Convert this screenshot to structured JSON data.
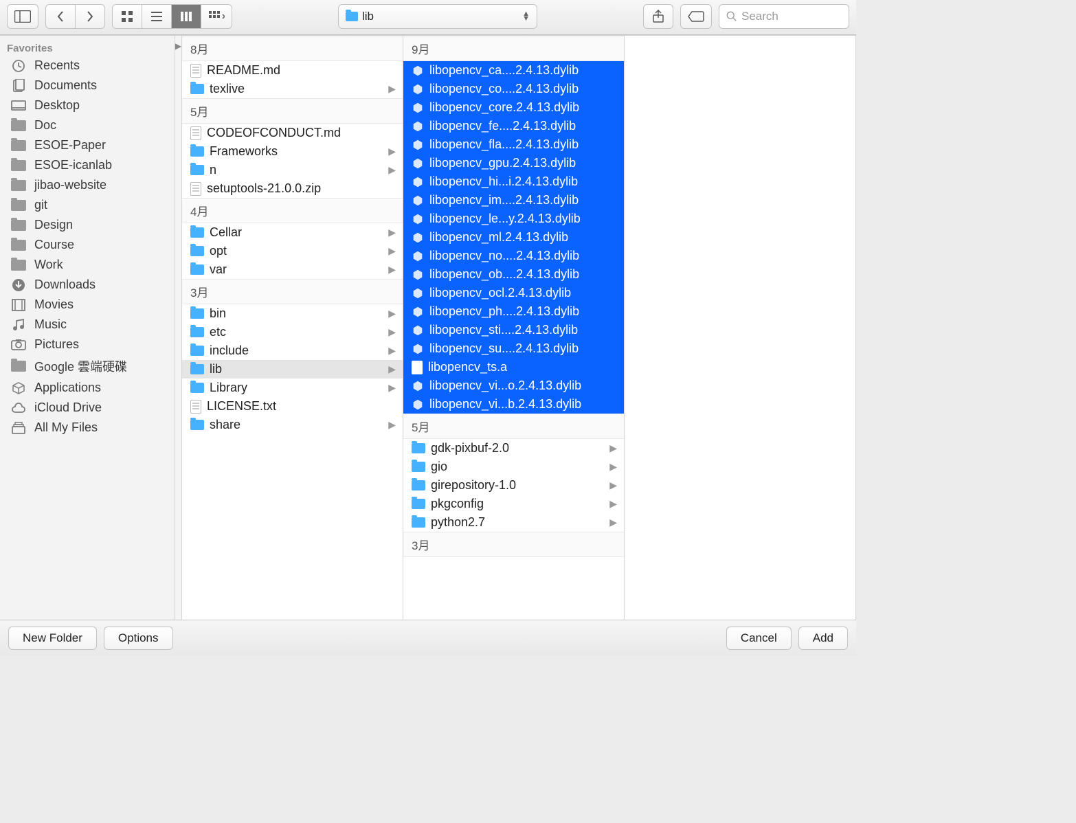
{
  "toolbar": {
    "path_label": "lib",
    "search_placeholder": "Search"
  },
  "sidebar": {
    "header": "Favorites",
    "items": [
      {
        "icon": "recents",
        "label": "Recents"
      },
      {
        "icon": "documents",
        "label": "Documents"
      },
      {
        "icon": "desktop",
        "label": "Desktop"
      },
      {
        "icon": "folder",
        "label": "Doc"
      },
      {
        "icon": "folder",
        "label": "ESOE-Paper"
      },
      {
        "icon": "folder",
        "label": "ESOE-icanlab"
      },
      {
        "icon": "folder",
        "label": "jibao-website"
      },
      {
        "icon": "folder",
        "label": "git"
      },
      {
        "icon": "folder",
        "label": "Design"
      },
      {
        "icon": "folder",
        "label": "Course"
      },
      {
        "icon": "folder",
        "label": "Work"
      },
      {
        "icon": "downloads",
        "label": "Downloads"
      },
      {
        "icon": "movies",
        "label": "Movies"
      },
      {
        "icon": "music",
        "label": "Music"
      },
      {
        "icon": "pictures",
        "label": "Pictures"
      },
      {
        "icon": "folder",
        "label": "Google 雲端硬碟"
      },
      {
        "icon": "applications",
        "label": "Applications"
      },
      {
        "icon": "icloud",
        "label": "iCloud Drive"
      },
      {
        "icon": "allfiles",
        "label": "All My Files"
      }
    ]
  },
  "column_mid": {
    "groups": [
      {
        "header": "8月",
        "items": [
          {
            "type": "doc",
            "name": "README.md"
          },
          {
            "type": "folder",
            "name": "texlive"
          }
        ]
      },
      {
        "header": "5月",
        "items": [
          {
            "type": "doc",
            "name": "CODEOFCONDUCT.md"
          },
          {
            "type": "folder",
            "name": "Frameworks"
          },
          {
            "type": "folder",
            "name": "n"
          },
          {
            "type": "doc",
            "name": "setuptools-21.0.0.zip"
          }
        ]
      },
      {
        "header": "4月",
        "items": [
          {
            "type": "folder",
            "name": "Cellar"
          },
          {
            "type": "folder",
            "name": "opt"
          },
          {
            "type": "folder",
            "name": "var"
          }
        ]
      },
      {
        "header": "3月",
        "items": [
          {
            "type": "folder",
            "name": "bin"
          },
          {
            "type": "folder",
            "name": "etc"
          },
          {
            "type": "folder",
            "name": "include"
          },
          {
            "type": "folder",
            "name": "lib",
            "selected": true
          },
          {
            "type": "folder",
            "name": "Library"
          },
          {
            "type": "doc",
            "name": "LICENSE.txt"
          },
          {
            "type": "folder",
            "name": "share"
          }
        ]
      }
    ]
  },
  "column_right": {
    "groups": [
      {
        "header": "9月",
        "selected": true,
        "items": [
          {
            "type": "dylib",
            "name": "libopencv_ca....2.4.13.dylib"
          },
          {
            "type": "dylib",
            "name": "libopencv_co....2.4.13.dylib"
          },
          {
            "type": "dylib",
            "name": "libopencv_core.2.4.13.dylib"
          },
          {
            "type": "dylib",
            "name": "libopencv_fe....2.4.13.dylib"
          },
          {
            "type": "dylib",
            "name": "libopencv_fla....2.4.13.dylib"
          },
          {
            "type": "dylib",
            "name": "libopencv_gpu.2.4.13.dylib"
          },
          {
            "type": "dylib",
            "name": "libopencv_hi...i.2.4.13.dylib"
          },
          {
            "type": "dylib",
            "name": "libopencv_im....2.4.13.dylib"
          },
          {
            "type": "dylib",
            "name": "libopencv_le...y.2.4.13.dylib"
          },
          {
            "type": "dylib",
            "name": "libopencv_ml.2.4.13.dylib"
          },
          {
            "type": "dylib",
            "name": "libopencv_no....2.4.13.dylib"
          },
          {
            "type": "dylib",
            "name": "libopencv_ob....2.4.13.dylib"
          },
          {
            "type": "dylib",
            "name": "libopencv_ocl.2.4.13.dylib"
          },
          {
            "type": "dylib",
            "name": "libopencv_ph....2.4.13.dylib"
          },
          {
            "type": "dylib",
            "name": "libopencv_sti....2.4.13.dylib"
          },
          {
            "type": "dylib",
            "name": "libopencv_su....2.4.13.dylib"
          },
          {
            "type": "file",
            "name": "libopencv_ts.a"
          },
          {
            "type": "dylib",
            "name": "libopencv_vi...o.2.4.13.dylib"
          },
          {
            "type": "dylib",
            "name": "libopencv_vi...b.2.4.13.dylib"
          }
        ]
      },
      {
        "header": "5月",
        "items": [
          {
            "type": "folder",
            "name": "gdk-pixbuf-2.0"
          },
          {
            "type": "folder",
            "name": "gio"
          },
          {
            "type": "folder",
            "name": "girepository-1.0"
          },
          {
            "type": "folder",
            "name": "pkgconfig"
          },
          {
            "type": "folder",
            "name": "python2.7"
          }
        ]
      },
      {
        "header": "3月",
        "items": []
      }
    ]
  },
  "footer": {
    "new_folder": "New Folder",
    "options": "Options",
    "cancel": "Cancel",
    "add": "Add"
  }
}
